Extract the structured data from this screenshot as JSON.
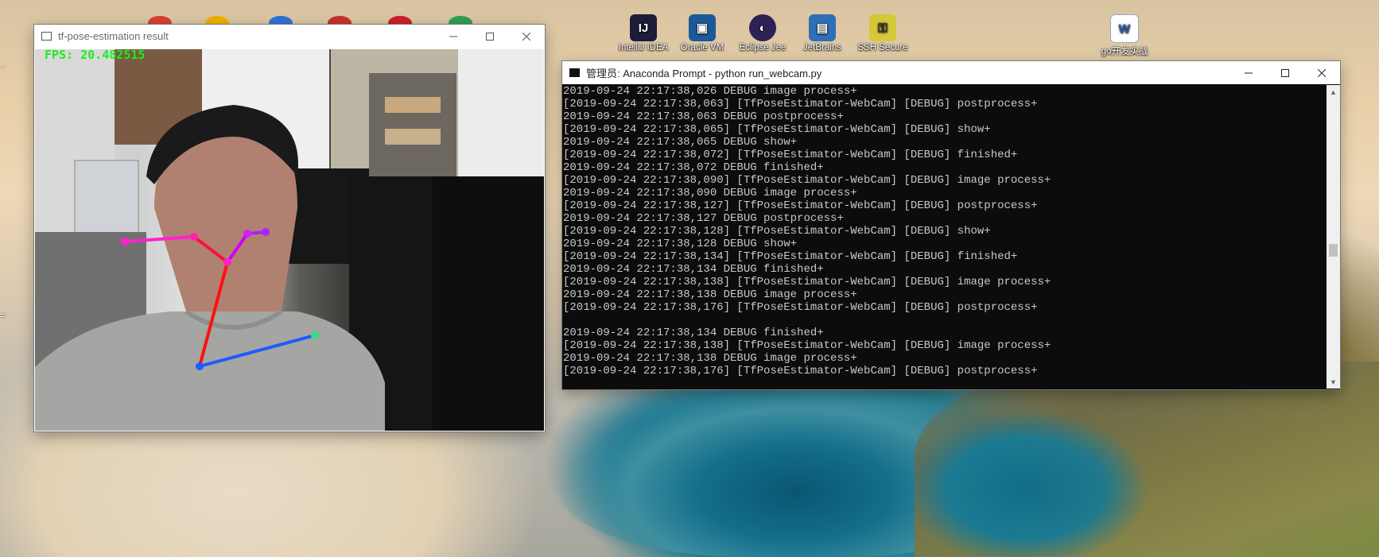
{
  "desktop": {
    "icons": [
      {
        "label": "IntelliJ IDEA",
        "icon": "intellij-icon",
        "color": "#1d1d3a",
        "glyph": "IJ"
      },
      {
        "label": "Oracle VM",
        "icon": "virtualbox-icon",
        "color": "#1b5a97",
        "glyph": "▣"
      },
      {
        "label": "Eclipse Jee",
        "icon": "eclipse-icon",
        "color": "#2c2255",
        "glyph": "◐"
      },
      {
        "label": "JetBrains",
        "icon": "jetbrains-icon",
        "color": "#2f6fb5",
        "glyph": "▤"
      },
      {
        "label": "SSH Secure",
        "icon": "ssh-icon",
        "color": "#d4c73a",
        "glyph": "⚿"
      },
      {
        "label": "go开发实战",
        "icon": "word-document-icon",
        "color": "#ffffff",
        "glyph": "W"
      }
    ]
  },
  "camera_window": {
    "title": "tf-pose-estimation result",
    "fps_text": "FPS: 20.482515"
  },
  "terminal_window": {
    "title": "管理员: Anaconda Prompt - python  run_webcam.py",
    "lines": [
      "2019-09-24 22:17:38,026 DEBUG image process+",
      "[2019-09-24 22:17:38,063] [TfPoseEstimator-WebCam] [DEBUG] postprocess+",
      "2019-09-24 22:17:38,063 DEBUG postprocess+",
      "[2019-09-24 22:17:38,065] [TfPoseEstimator-WebCam] [DEBUG] show+",
      "2019-09-24 22:17:38,065 DEBUG show+",
      "[2019-09-24 22:17:38,072] [TfPoseEstimator-WebCam] [DEBUG] finished+",
      "2019-09-24 22:17:38,072 DEBUG finished+",
      "[2019-09-24 22:17:38,090] [TfPoseEstimator-WebCam] [DEBUG] image process+",
      "2019-09-24 22:17:38,090 DEBUG image process+",
      "[2019-09-24 22:17:38,127] [TfPoseEstimator-WebCam] [DEBUG] postprocess+",
      "2019-09-24 22:17:38,127 DEBUG postprocess+",
      "[2019-09-24 22:17:38,128] [TfPoseEstimator-WebCam] [DEBUG] show+",
      "2019-09-24 22:17:38,128 DEBUG show+",
      "[2019-09-24 22:17:38,134] [TfPoseEstimator-WebCam] [DEBUG] finished+",
      "2019-09-24 22:17:38,134 DEBUG finished+",
      "[2019-09-24 22:17:38,138] [TfPoseEstimator-WebCam] [DEBUG] image process+",
      "2019-09-24 22:17:38,138 DEBUG image process+",
      "[2019-09-24 22:17:38,176] [TfPoseEstimator-WebCam] [DEBUG] postprocess+",
      "",
      "2019-09-24 22:17:38,134 DEBUG finished+",
      "[2019-09-24 22:17:38,138] [TfPoseEstimator-WebCam] [DEBUG] image process+",
      "2019-09-24 22:17:38,138 DEBUG image process+",
      "[2019-09-24 22:17:38,176] [TfPoseEstimator-WebCam] [DEBUG] postprocess+"
    ]
  },
  "colors": {
    "console_text": "#c8c8c8",
    "fps_text": "#18f018",
    "skeleton_neck": "#ff1010",
    "skeleton_face": "#ff22cc",
    "skeleton_shoulder": "#1a5cff"
  }
}
